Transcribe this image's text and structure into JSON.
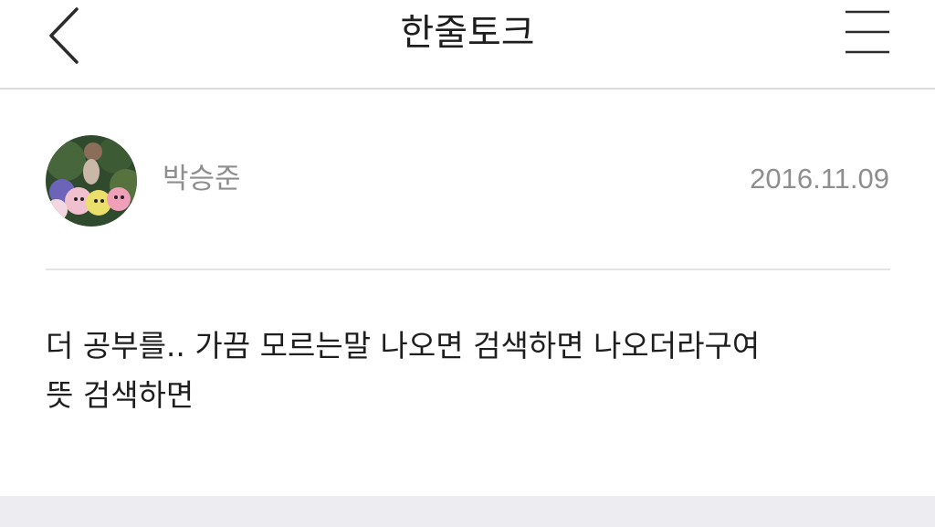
{
  "header": {
    "title": "한줄토크",
    "back_icon": "chevron-left-icon",
    "menu_icon": "hamburger-menu-icon"
  },
  "post": {
    "author": "박승준",
    "date": "2016.11.09",
    "avatar": "avatar-image",
    "body_lines": [
      "더 공부를.. 가끔 모르는말 나오면 검색하면 나오더라구여",
      "뜻 검색하면"
    ]
  },
  "colors": {
    "background": "#ffffff",
    "text": "#1e1e1e",
    "meta_text": "#8e8e8e",
    "divider": "#dcdcdc",
    "footer": "#ececf1"
  }
}
